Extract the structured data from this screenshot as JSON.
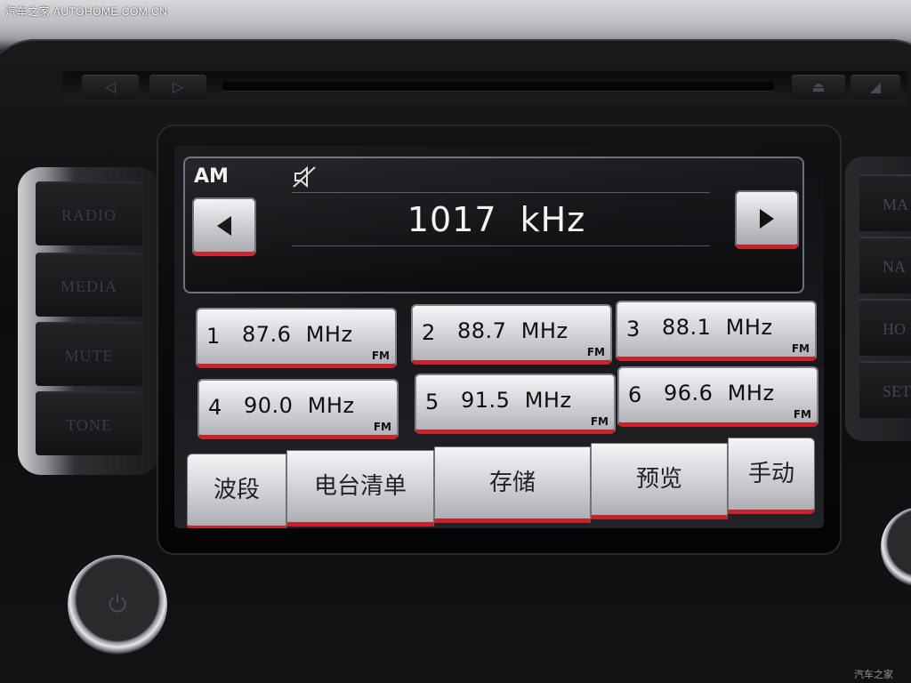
{
  "watermark": {
    "top_left": "汽车之家  AUTOHOME.COM.CN",
    "bottom_right": "汽车之家"
  },
  "hardware": {
    "left_buttons": [
      "RADIO",
      "MEDIA",
      "MUTE",
      "TONE"
    ],
    "right_buttons": [
      "MA",
      "NA",
      "HO",
      "SET"
    ]
  },
  "tuner": {
    "band": "AM",
    "frequency": "1017  kHz",
    "mute_icon": "speaker-muted-icon",
    "seek_back_icon": "triangle-left-icon",
    "seek_forward_icon": "triangle-right-icon"
  },
  "presets": [
    {
      "num": "1",
      "freq": "87.6  MHz",
      "band": "FM"
    },
    {
      "num": "2",
      "freq": "88.7  MHz",
      "band": "FM"
    },
    {
      "num": "3",
      "freq": "88.1  MHz",
      "band": "FM"
    },
    {
      "num": "4",
      "freq": "90.0  MHz",
      "band": "FM"
    },
    {
      "num": "5",
      "freq": "91.5  MHz",
      "band": "FM"
    },
    {
      "num": "6",
      "freq": "96.6  MHz",
      "band": "FM"
    }
  ],
  "menu": {
    "band": "波段",
    "station_list": "电台清单",
    "store": "存储",
    "preview": "预览",
    "manual": "手动"
  },
  "colors": {
    "accent_red": "#c8232b",
    "button_silver": "#d4d5d9",
    "screen_bg": "#0f1012"
  }
}
